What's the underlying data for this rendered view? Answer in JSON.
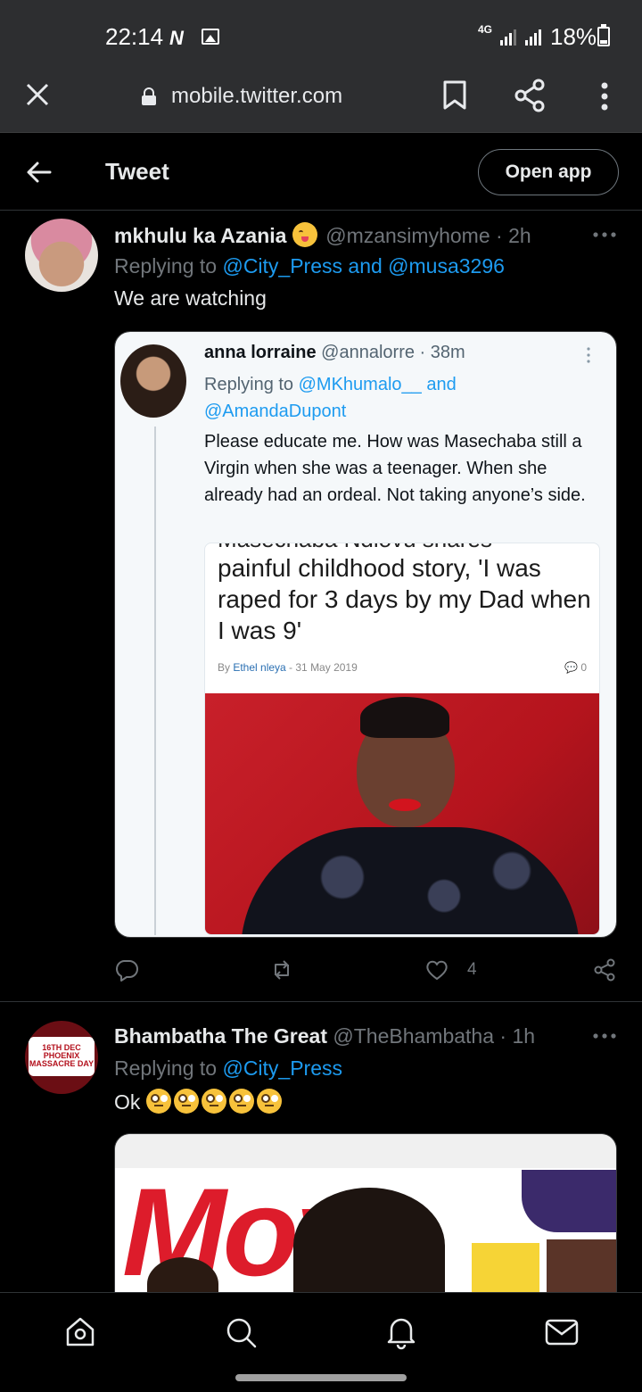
{
  "status_bar": {
    "time": "22:14",
    "network": "4G",
    "battery": "18%"
  },
  "browser": {
    "url": "mobile.twitter.com"
  },
  "header": {
    "title": "Tweet",
    "open_app": "Open app"
  },
  "tweets": [
    {
      "name": "mkhulu ka Azania",
      "handle": "@mzansimyhome",
      "time": "· 2h",
      "replying_prefix": "Replying to ",
      "replying_to": "@City_Press and @musa3296",
      "text": "We are watching",
      "like_count": "4",
      "embedded": {
        "name": "anna lorraine",
        "handle": "@annalorre · 38m",
        "replying_prefix": "Replying to ",
        "replying_to_1": "@MKhumalo__",
        "replying_and": " and",
        "replying_to_2": "@AmandaDupont",
        "text": "Please educate me. How was Masechaba still a Virgin when she was a teenager. When she already had an ordeal. Not taking anyone’s side.",
        "article": {
          "title_cut": "Masechaba Ndlovu shares",
          "title": "painful childhood story, 'I was raped for 3 days by my Dad when I was 9'",
          "by": "By ",
          "author": "Ethel nleya",
          "date": " - 31 May 2019",
          "comments": "0"
        }
      }
    },
    {
      "name": "Bhambatha The Great",
      "handle": "@TheBhambatha",
      "time": "· 1h",
      "replying_prefix": "Replying to ",
      "replying_to": "@City_Press",
      "text": "Ok",
      "avatar_text": "16TH DEC PHOENIX MASSACRE DAY",
      "cover_logo": "Move"
    }
  ],
  "colors": {
    "background": "#000000",
    "link": "#1d9bf0",
    "muted": "#71767b",
    "chrome": "#2d2e30"
  }
}
